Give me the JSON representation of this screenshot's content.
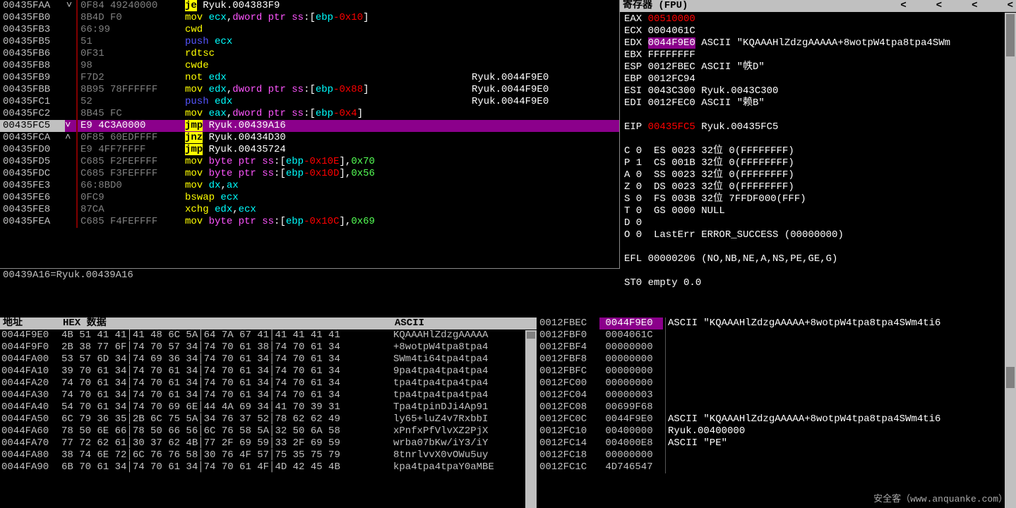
{
  "disasm": {
    "selected_idx": 12,
    "info_line": "00439A16=Ryuk.00439A16",
    "rows": [
      {
        "addr": "00435FAA",
        "gut": "˅",
        "bytes": "0F84 49240000",
        "op": "je",
        "optype": "jmp",
        "args": {
          "text": " Ryuk.004383F9",
          "parts": [
            [
              "w",
              " Ryuk.004383F9"
            ]
          ]
        },
        "cmt": ""
      },
      {
        "addr": "00435FB0",
        "gut": "",
        "bytes": "8B4D F0",
        "op": "mov",
        "optype": "plain",
        "args": {
          "parts": [
            [
              "cyan",
              " ecx"
            ],
            [
              "w",
              ","
            ],
            [
              "mag",
              "dword ptr ss"
            ],
            [
              "w",
              ":["
            ],
            [
              "cyan",
              "ebp"
            ],
            [
              "red",
              "-0x10"
            ],
            [
              "w",
              "]"
            ]
          ]
        },
        "cmt": ""
      },
      {
        "addr": "00435FB3",
        "gut": "",
        "bytes": "66:99",
        "op": "cwd",
        "optype": "plain",
        "args": {
          "parts": []
        },
        "cmt": ""
      },
      {
        "addr": "00435FB5",
        "gut": "",
        "bytes": "51",
        "op": "push",
        "optype": "blue",
        "args": {
          "parts": [
            [
              "cyan",
              " ecx"
            ]
          ]
        },
        "cmt": ""
      },
      {
        "addr": "00435FB6",
        "gut": "",
        "bytes": "0F31",
        "op": "rdtsc",
        "optype": "plain",
        "args": {
          "parts": []
        },
        "cmt": ""
      },
      {
        "addr": "00435FB8",
        "gut": "",
        "bytes": "98",
        "op": "cwde",
        "optype": "plain",
        "args": {
          "parts": []
        },
        "cmt": ""
      },
      {
        "addr": "00435FB9",
        "gut": "",
        "bytes": "F7D2",
        "op": "not",
        "optype": "plain",
        "args": {
          "parts": [
            [
              "cyan",
              " edx"
            ]
          ]
        },
        "cmt": "Ryuk.0044F9E0"
      },
      {
        "addr": "00435FBB",
        "gut": "",
        "bytes": "8B95 78FFFFFF",
        "op": "mov",
        "optype": "plain",
        "args": {
          "parts": [
            [
              "cyan",
              " edx"
            ],
            [
              "w",
              ","
            ],
            [
              "mag",
              "dword ptr ss"
            ],
            [
              "w",
              ":["
            ],
            [
              "cyan",
              "ebp"
            ],
            [
              "red",
              "-0x88"
            ],
            [
              "w",
              "]"
            ]
          ]
        },
        "cmt": "Ryuk.0044F9E0"
      },
      {
        "addr": "00435FC1",
        "gut": "",
        "bytes": "52",
        "op": "push",
        "optype": "blue",
        "args": {
          "parts": [
            [
              "cyan",
              " edx"
            ]
          ]
        },
        "cmt": "Ryuk.0044F9E0"
      },
      {
        "addr": "00435FC2",
        "gut": "",
        "bytes": "8B45 FC",
        "op": "mov",
        "optype": "plain",
        "args": {
          "parts": [
            [
              "cyan",
              " eax"
            ],
            [
              "w",
              ","
            ],
            [
              "mag",
              "dword ptr ss"
            ],
            [
              "w",
              ":["
            ],
            [
              "cyan",
              "ebp"
            ],
            [
              "red",
              "-0x4"
            ],
            [
              "w",
              "]"
            ]
          ]
        },
        "cmt": ""
      },
      {
        "addr": "00435FC5",
        "gut": "˅ ",
        "bytes": "E9 4C3A0000",
        "op": "jmp",
        "optype": "jmp",
        "args": {
          "parts": [
            [
              "w",
              " Ryuk.00439A16"
            ]
          ]
        },
        "cmt": ""
      },
      {
        "addr": "00435FCA",
        "gut": "˄ ",
        "bytes": "0F85 60EDFFFF",
        "op": "jnz",
        "optype": "jmp",
        "args": {
          "parts": [
            [
              "w",
              " Ryuk.00434D30"
            ]
          ]
        },
        "cmt": ""
      },
      {
        "addr": "00435FD0",
        "gut": "",
        "bytes": "E9 4FF7FFFF",
        "op": "jmp",
        "optype": "jmp",
        "args": {
          "parts": [
            [
              "w",
              " Ryuk.00435724"
            ]
          ]
        },
        "cmt": ""
      },
      {
        "addr": "00435FD5",
        "gut": "",
        "bytes": "C685 F2FEFFFF ",
        "op": "mov",
        "optype": "plain",
        "args": {
          "parts": [
            [
              "mag",
              " byte ptr ss"
            ],
            [
              "w",
              ":["
            ],
            [
              "cyan",
              "ebp"
            ],
            [
              "red",
              "-0x10E"
            ],
            [
              "w",
              "],"
            ],
            [
              "grn",
              "0x70"
            ]
          ]
        },
        "cmt": ""
      },
      {
        "addr": "00435FDC",
        "gut": "",
        "bytes": "C685 F3FEFFFF ",
        "op": "mov",
        "optype": "plain",
        "args": {
          "parts": [
            [
              "mag",
              " byte ptr ss"
            ],
            [
              "w",
              ":["
            ],
            [
              "cyan",
              "ebp"
            ],
            [
              "red",
              "-0x10D"
            ],
            [
              "w",
              "],"
            ],
            [
              "grn",
              "0x56"
            ]
          ]
        },
        "cmt": ""
      },
      {
        "addr": "00435FE3",
        "gut": "",
        "bytes": "66:8BD0",
        "op": "mov",
        "optype": "plain",
        "args": {
          "parts": [
            [
              "cyan",
              " dx"
            ],
            [
              "w",
              ","
            ],
            [
              "cyan",
              "ax"
            ]
          ]
        },
        "cmt": ""
      },
      {
        "addr": "00435FE6",
        "gut": "",
        "bytes": "0FC9",
        "op": "bswap",
        "optype": "plain",
        "args": {
          "parts": [
            [
              "cyan",
              " ecx"
            ]
          ]
        },
        "cmt": ""
      },
      {
        "addr": "00435FE8",
        "gut": "",
        "bytes": "87CA",
        "op": "xchg",
        "optype": "plain",
        "args": {
          "parts": [
            [
              "cyan",
              " edx"
            ],
            [
              "w",
              ","
            ],
            [
              "cyan",
              "ecx"
            ]
          ]
        },
        "cmt": ""
      },
      {
        "addr": "00435FEA",
        "gut": "",
        "bytes": "C685 F4FEFFFF ",
        "op": "mov",
        "optype": "plain",
        "args": {
          "parts": [
            [
              "mag",
              " byte ptr ss"
            ],
            [
              "w",
              ":["
            ],
            [
              "cyan",
              "ebp"
            ],
            [
              "red",
              "-0x10C"
            ],
            [
              "w",
              "],"
            ],
            [
              "grn",
              "0x69"
            ]
          ]
        },
        "cmt": ""
      }
    ]
  },
  "regs": {
    "title": "寄存器 (FPU)",
    "nav": "<     <     <     <",
    "lines": [
      [
        [
          "w",
          "EAX "
        ],
        [
          "red",
          "00510000"
        ]
      ],
      [
        [
          "w",
          "ECX 0004061C"
        ]
      ],
      [
        [
          "w",
          "EDX "
        ],
        [
          "sel",
          "0044F9E0"
        ],
        [
          "w",
          " ASCII \"KQAAAHlZdzgAAAAA+8wotpW4tpa8tpa4SWm"
        ]
      ],
      [
        [
          "w",
          "EBX FFFFFFFF"
        ]
      ],
      [
        [
          "w",
          "ESP 0012FBEC ASCII \"帙D\""
        ]
      ],
      [
        [
          "w",
          "EBP 0012FC94"
        ]
      ],
      [
        [
          "w",
          "ESI 0043C300 Ryuk.0043C300"
        ]
      ],
      [
        [
          "w",
          "EDI 0012FEC0 ASCII \"赖B\""
        ]
      ],
      [
        [
          "",
          "  "
        ]
      ],
      [
        [
          "w",
          "EIP "
        ],
        [
          "red",
          "00435FC5"
        ],
        [
          "w",
          " Ryuk.00435FC5"
        ]
      ],
      [
        [
          "",
          "  "
        ]
      ],
      [
        [
          "w",
          "C 0  ES 0023 32位 0(FFFFFFFF)"
        ]
      ],
      [
        [
          "w",
          "P 1  CS 001B 32位 0(FFFFFFFF)"
        ]
      ],
      [
        [
          "w",
          "A 0  SS 0023 32位 0(FFFFFFFF)"
        ]
      ],
      [
        [
          "w",
          "Z 0  DS 0023 32位 0(FFFFFFFF)"
        ]
      ],
      [
        [
          "w",
          "S 0  FS 003B 32位 7FFDF000(FFF)"
        ]
      ],
      [
        [
          "w",
          "T 0  GS 0000 NULL"
        ]
      ],
      [
        [
          "w",
          "D 0"
        ]
      ],
      [
        [
          "w",
          "O 0  LastErr ERROR_SUCCESS (00000000)"
        ]
      ],
      [
        [
          "",
          "  "
        ]
      ],
      [
        [
          "w",
          "EFL 00000206 (NO,NB,NE,A,NS,PE,GE,G)"
        ]
      ],
      [
        [
          "",
          "  "
        ]
      ],
      [
        [
          "w",
          "ST0 empty 0.0"
        ]
      ]
    ]
  },
  "hex": {
    "hdr_addr": "地址",
    "hdr_hex": "HEX 数据",
    "hdr_ascii": "ASCII",
    "rows": [
      {
        "a": "0044F9E0",
        "h": "4B 51 41 41│41 48 6C 5A│64 7A 67 41│41 41 41 41",
        "s": "KQAAAHlZdzgAAAAA"
      },
      {
        "a": "0044F9F0",
        "h": "2B 38 77 6F│74 70 57 34│74 70 61 38│74 70 61 34",
        "s": "+8wotpW4tpa8tpa4"
      },
      {
        "a": "0044FA00",
        "h": "53 57 6D 34│74 69 36 34│74 70 61 34│74 70 61 34",
        "s": "SWm4ti64tpa4tpa4"
      },
      {
        "a": "0044FA10",
        "h": "39 70 61 34│74 70 61 34│74 70 61 34│74 70 61 34",
        "s": "9pa4tpa4tpa4tpa4"
      },
      {
        "a": "0044FA20",
        "h": "74 70 61 34│74 70 61 34│74 70 61 34│74 70 61 34",
        "s": "tpa4tpa4tpa4tpa4"
      },
      {
        "a": "0044FA30",
        "h": "74 70 61 34│74 70 61 34│74 70 61 34│74 70 61 34",
        "s": "tpa4tpa4tpa4tpa4"
      },
      {
        "a": "0044FA40",
        "h": "54 70 61 34│74 70 69 6E│44 4A 69 34│41 70 39 31",
        "s": "Tpa4tpinDJi4Ap91"
      },
      {
        "a": "0044FA50",
        "h": "6C 79 36 35│2B 6C 75 5A│34 76 37 52│78 62 62 49",
        "s": "ly65+luZ4v7RxbbI"
      },
      {
        "a": "0044FA60",
        "h": "78 50 6E 66│78 50 66 56│6C 76 58 5A│32 50 6A 58",
        "s": "xPnfxPfVlvXZ2PjX"
      },
      {
        "a": "0044FA70",
        "h": "77 72 62 61│30 37 62 4B│77 2F 69 59│33 2F 69 59",
        "s": "wrba07bKw/iY3/iY"
      },
      {
        "a": "0044FA80",
        "h": "38 74 6E 72│6C 76 76 58│30 76 4F 57│75 35 75 79",
        "s": "8tnrlvvX0vOWu5uy"
      },
      {
        "a": "0044FA90",
        "h": "6B 70 61 34│74 70 61 34│74 70 61 4F│4D 42 45 4B",
        "s": "kpa4tpa4tpaY0aMBE"
      }
    ]
  },
  "stack": {
    "sel_idx": 0,
    "rows": [
      {
        "a": "0012FBEC",
        "v": "0044F9E0",
        "c": "ASCII \"KQAAAHlZdzgAAAAA+8wotpW4tpa8tpa4SWm4ti6"
      },
      {
        "a": "0012FBF0",
        "v": "0004061C",
        "c": ""
      },
      {
        "a": "0012FBF4",
        "v": "00000000",
        "c": ""
      },
      {
        "a": "0012FBF8",
        "v": "00000000",
        "c": ""
      },
      {
        "a": "0012FBFC",
        "v": "00000000",
        "c": ""
      },
      {
        "a": "0012FC00",
        "v": "00000000",
        "c": ""
      },
      {
        "a": "0012FC04",
        "v": "00000003",
        "c": ""
      },
      {
        "a": "0012FC08",
        "v": "00699F68",
        "c": ""
      },
      {
        "a": "0012FC0C",
        "v": "0044F9E0",
        "c": "ASCII \"KQAAAHlZdzgAAAAA+8wotpW4tpa8tpa4SWm4ti6"
      },
      {
        "a": "0012FC10",
        "v": "00400000",
        "c": "Ryuk.00400000"
      },
      {
        "a": "0012FC14",
        "v": "004000E8",
        "c": "ASCII \"PE\""
      },
      {
        "a": "0012FC18",
        "v": "00000000",
        "c": ""
      },
      {
        "a": "0012FC1C",
        "v": "4D746547",
        "c": ""
      }
    ]
  },
  "watermark": "安全客（www.anquanke.com）"
}
